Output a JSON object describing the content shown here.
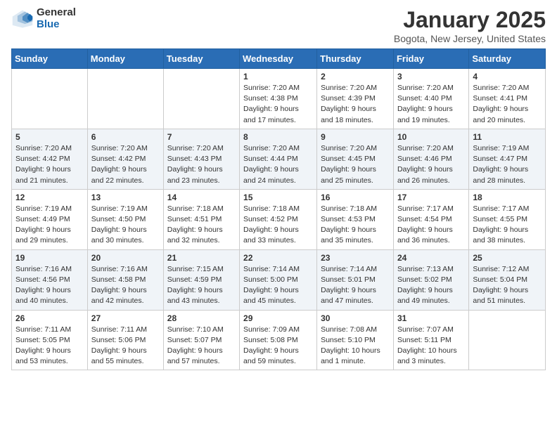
{
  "logo": {
    "general": "General",
    "blue": "Blue"
  },
  "title": "January 2025",
  "location": "Bogota, New Jersey, United States",
  "weekdays": [
    "Sunday",
    "Monday",
    "Tuesday",
    "Wednesday",
    "Thursday",
    "Friday",
    "Saturday"
  ],
  "weeks": [
    [
      {
        "day": "",
        "info": ""
      },
      {
        "day": "",
        "info": ""
      },
      {
        "day": "",
        "info": ""
      },
      {
        "day": "1",
        "sunrise": "7:20 AM",
        "sunset": "4:38 PM",
        "daylight": "9 hours and 17 minutes."
      },
      {
        "day": "2",
        "sunrise": "7:20 AM",
        "sunset": "4:39 PM",
        "daylight": "9 hours and 18 minutes."
      },
      {
        "day": "3",
        "sunrise": "7:20 AM",
        "sunset": "4:40 PM",
        "daylight": "9 hours and 19 minutes."
      },
      {
        "day": "4",
        "sunrise": "7:20 AM",
        "sunset": "4:41 PM",
        "daylight": "9 hours and 20 minutes."
      }
    ],
    [
      {
        "day": "5",
        "sunrise": "7:20 AM",
        "sunset": "4:42 PM",
        "daylight": "9 hours and 21 minutes."
      },
      {
        "day": "6",
        "sunrise": "7:20 AM",
        "sunset": "4:42 PM",
        "daylight": "9 hours and 22 minutes."
      },
      {
        "day": "7",
        "sunrise": "7:20 AM",
        "sunset": "4:43 PM",
        "daylight": "9 hours and 23 minutes."
      },
      {
        "day": "8",
        "sunrise": "7:20 AM",
        "sunset": "4:44 PM",
        "daylight": "9 hours and 24 minutes."
      },
      {
        "day": "9",
        "sunrise": "7:20 AM",
        "sunset": "4:45 PM",
        "daylight": "9 hours and 25 minutes."
      },
      {
        "day": "10",
        "sunrise": "7:20 AM",
        "sunset": "4:46 PM",
        "daylight": "9 hours and 26 minutes."
      },
      {
        "day": "11",
        "sunrise": "7:19 AM",
        "sunset": "4:47 PM",
        "daylight": "9 hours and 28 minutes."
      }
    ],
    [
      {
        "day": "12",
        "sunrise": "7:19 AM",
        "sunset": "4:49 PM",
        "daylight": "9 hours and 29 minutes."
      },
      {
        "day": "13",
        "sunrise": "7:19 AM",
        "sunset": "4:50 PM",
        "daylight": "9 hours and 30 minutes."
      },
      {
        "day": "14",
        "sunrise": "7:18 AM",
        "sunset": "4:51 PM",
        "daylight": "9 hours and 32 minutes."
      },
      {
        "day": "15",
        "sunrise": "7:18 AM",
        "sunset": "4:52 PM",
        "daylight": "9 hours and 33 minutes."
      },
      {
        "day": "16",
        "sunrise": "7:18 AM",
        "sunset": "4:53 PM",
        "daylight": "9 hours and 35 minutes."
      },
      {
        "day": "17",
        "sunrise": "7:17 AM",
        "sunset": "4:54 PM",
        "daylight": "9 hours and 36 minutes."
      },
      {
        "day": "18",
        "sunrise": "7:17 AM",
        "sunset": "4:55 PM",
        "daylight": "9 hours and 38 minutes."
      }
    ],
    [
      {
        "day": "19",
        "sunrise": "7:16 AM",
        "sunset": "4:56 PM",
        "daylight": "9 hours and 40 minutes."
      },
      {
        "day": "20",
        "sunrise": "7:16 AM",
        "sunset": "4:58 PM",
        "daylight": "9 hours and 42 minutes."
      },
      {
        "day": "21",
        "sunrise": "7:15 AM",
        "sunset": "4:59 PM",
        "daylight": "9 hours and 43 minutes."
      },
      {
        "day": "22",
        "sunrise": "7:14 AM",
        "sunset": "5:00 PM",
        "daylight": "9 hours and 45 minutes."
      },
      {
        "day": "23",
        "sunrise": "7:14 AM",
        "sunset": "5:01 PM",
        "daylight": "9 hours and 47 minutes."
      },
      {
        "day": "24",
        "sunrise": "7:13 AM",
        "sunset": "5:02 PM",
        "daylight": "9 hours and 49 minutes."
      },
      {
        "day": "25",
        "sunrise": "7:12 AM",
        "sunset": "5:04 PM",
        "daylight": "9 hours and 51 minutes."
      }
    ],
    [
      {
        "day": "26",
        "sunrise": "7:11 AM",
        "sunset": "5:05 PM",
        "daylight": "9 hours and 53 minutes."
      },
      {
        "day": "27",
        "sunrise": "7:11 AM",
        "sunset": "5:06 PM",
        "daylight": "9 hours and 55 minutes."
      },
      {
        "day": "28",
        "sunrise": "7:10 AM",
        "sunset": "5:07 PM",
        "daylight": "9 hours and 57 minutes."
      },
      {
        "day": "29",
        "sunrise": "7:09 AM",
        "sunset": "5:08 PM",
        "daylight": "9 hours and 59 minutes."
      },
      {
        "day": "30",
        "sunrise": "7:08 AM",
        "sunset": "5:10 PM",
        "daylight": "10 hours and 1 minute."
      },
      {
        "day": "31",
        "sunrise": "7:07 AM",
        "sunset": "5:11 PM",
        "daylight": "10 hours and 3 minutes."
      },
      {
        "day": "",
        "info": ""
      }
    ]
  ]
}
